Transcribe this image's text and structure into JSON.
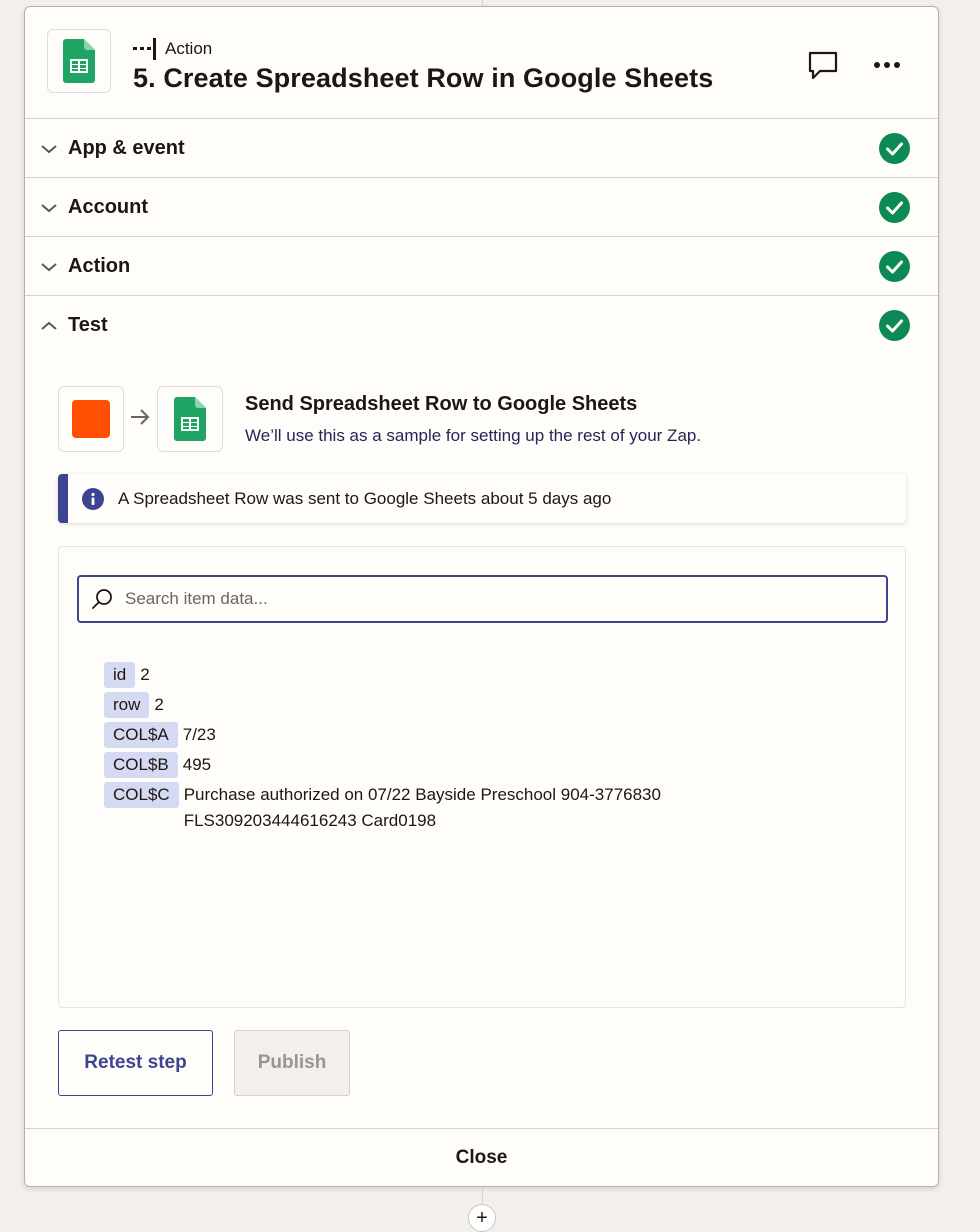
{
  "header": {
    "step_kind": "Action",
    "step_title": "5. Create Spreadsheet Row in Google Sheets",
    "app_icon": "google-sheets-icon",
    "comment_icon": "comment-icon",
    "more_icon": "more-options-icon"
  },
  "sections": [
    {
      "label": "App & event",
      "expanded": false,
      "status": "complete"
    },
    {
      "label": "Account",
      "expanded": false,
      "status": "complete"
    },
    {
      "label": "Action",
      "expanded": false,
      "status": "complete"
    },
    {
      "label": "Test",
      "expanded": true,
      "status": "complete"
    }
  ],
  "test": {
    "flow_title": "Send Spreadsheet Row to Google Sheets",
    "flow_subtitle": "We’ll use this as a sample for setting up the rest of your Zap.",
    "info_message": "A Spreadsheet Row was sent to Google Sheets about 5 days ago",
    "search": {
      "placeholder": "Search item data...",
      "value": ""
    },
    "items": [
      {
        "key": "id",
        "value": "2"
      },
      {
        "key": "row",
        "value": "2"
      },
      {
        "key": "COL$A",
        "value": "7/23"
      },
      {
        "key": "COL$B",
        "value": "495"
      },
      {
        "key": "COL$C",
        "value": "Purchase authorized on 07/22 Bayside Preschool 904-3776830\nFLS309203444616243 Card0198"
      }
    ],
    "retest_label": "Retest step",
    "publish_label": "Publish"
  },
  "footer": {
    "close_label": "Close"
  },
  "colors": {
    "accent": "#3d4592",
    "success": "#0b8a55",
    "trigger_orange": "#ff4f00",
    "sheets_green": "#1fa463",
    "key_chip": "#d5daf3"
  }
}
